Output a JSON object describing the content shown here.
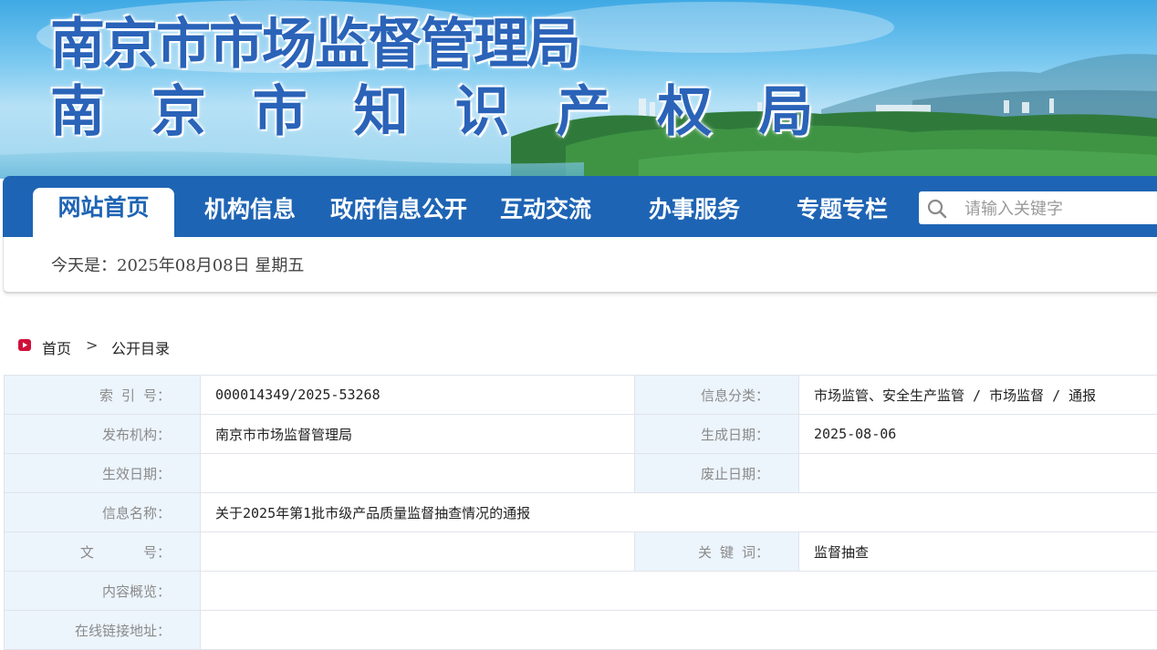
{
  "banner": {
    "title_line1": "南京市市场监督管理局",
    "title_line2": "南 京 市 知 识 产 权 局"
  },
  "nav": {
    "items": [
      {
        "label": "网站首页",
        "active": true
      },
      {
        "label": "机构信息"
      },
      {
        "label": "政府信息公开"
      },
      {
        "label": "互动交流"
      },
      {
        "label": "办事服务"
      },
      {
        "label": "专题专栏"
      }
    ],
    "search_placeholder": "请输入关键字",
    "search_icon": "search-icon"
  },
  "datebar": {
    "text": "今天是：2025年08月08日 星期五"
  },
  "breadcrumb": {
    "home": "首页",
    "separator": ">",
    "current": "公开目录"
  },
  "info": {
    "index_label": "索 引 号：",
    "index_value": "000014349/2025-53268",
    "category_label": "信息分类：",
    "category_value": "市场监管、安全生产监管 / 市场监督 / 通报",
    "publisher_label": "发布机构：",
    "publisher_value": "南京市市场监督管理局",
    "created_label": "生成日期：",
    "created_value": "2025-08-06",
    "effective_label": "生效日期：",
    "effective_value": "",
    "expire_label": "废止日期：",
    "expire_value": "",
    "name_label": "信息名称：",
    "name_value": "关于2025年第1批市级产品质量监督抽查情况的通报",
    "docno_label": "文      号：",
    "docno_value": "",
    "keywords_label": "关 键 词：",
    "keywords_value": "监督抽查",
    "summary_label": "内容概览：",
    "summary_value": "",
    "link_label": "在线链接地址：",
    "link_value": ""
  },
  "colors": {
    "nav_blue": "#1e64b4",
    "label_bg": "#ecf4fc",
    "breadcrumb_icon": "#d0103a"
  }
}
